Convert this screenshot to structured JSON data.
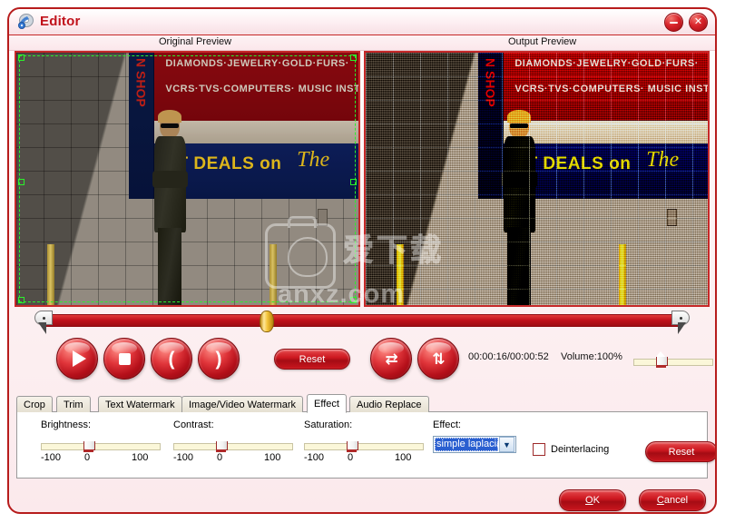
{
  "window": {
    "title": "Editor",
    "icon": "disc-icon",
    "minimize_label": "−",
    "close_label": "✕",
    "accent_color": "#c0121b",
    "border_color": "#b71c1c"
  },
  "previews": {
    "original_label": "Original Preview",
    "output_label": "Output Preview",
    "scene": {
      "sign_vertical": "N SHOP",
      "banner_line1": "DIAMONDS·JEWELRY·GOLD·FURS·",
      "banner_line2": "VCRS·TVS·COMPUTERS· MUSIC INST.·C",
      "banner_line3": "ST DEALS on",
      "banner_script": "The"
    },
    "crop_selection": true
  },
  "watermark": {
    "logo_text": "爱下载",
    "site_text": "anxz.com"
  },
  "transport": {
    "play_label": "▶",
    "stop_label": "■",
    "mark_in_label": "(",
    "mark_out_label": ")",
    "reset_label": "Reset",
    "swap_horizontal_label": "⇄",
    "swap_vertical_label": "⇅",
    "time_text": "00:00:16/00:00:52",
    "volume_text": "Volume:100%",
    "volume_value": 100,
    "position_seconds": 16,
    "duration_seconds": 52
  },
  "tabs": [
    {
      "label": "Crop",
      "active": false
    },
    {
      "label": "Trim",
      "active": false
    },
    {
      "label": "Text Watermark",
      "active": false
    },
    {
      "label": "Image/Video Watermark",
      "active": false
    },
    {
      "label": "Effect",
      "active": true
    },
    {
      "label": "Audio Replace",
      "active": false
    }
  ],
  "effect_panel": {
    "brightness": {
      "label": "Brightness:",
      "min": "-100",
      "mid": "0",
      "max": "100",
      "value": 0
    },
    "contrast": {
      "label": "Contrast:",
      "min": "-100",
      "mid": "0",
      "max": "100",
      "value": 0
    },
    "saturation": {
      "label": "Saturation:",
      "min": "-100",
      "mid": "0",
      "max": "100",
      "value": 0
    },
    "effect": {
      "label": "Effect:",
      "selected": "simple laplacian",
      "arrow": "▼"
    },
    "deinterlacing": {
      "label": "Deinterlacing",
      "checked": false
    },
    "reset_label": "Reset"
  },
  "footer": {
    "ok_accel": "O",
    "ok_rest": "K",
    "cancel_accel": "C",
    "cancel_rest": "ancel"
  }
}
